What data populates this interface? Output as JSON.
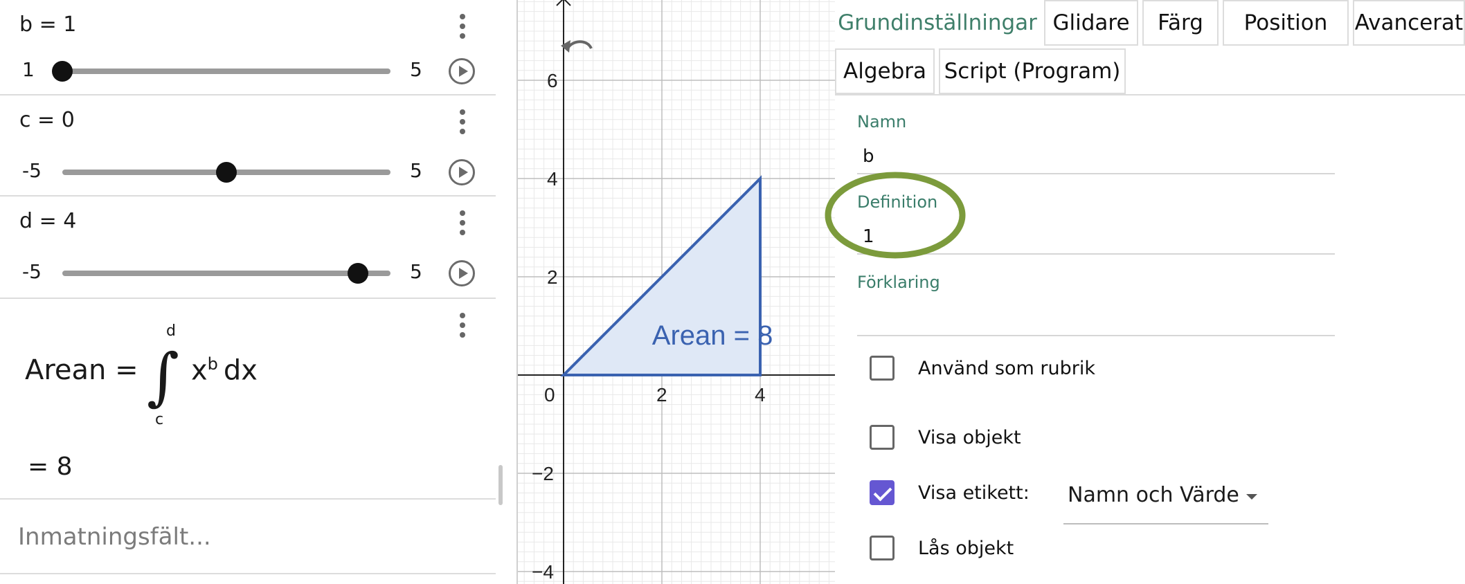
{
  "algebra": {
    "sliders": [
      {
        "definition": "b = 1",
        "min": "1",
        "max": "5",
        "value": 1,
        "range": [
          1,
          5
        ]
      },
      {
        "definition": "c = 0",
        "min": "-5",
        "max": "5",
        "value": 0,
        "range": [
          -5,
          5
        ]
      },
      {
        "definition": "d = 4",
        "min": "-5",
        "max": "5",
        "value": 4,
        "range": [
          -5,
          5
        ]
      }
    ],
    "integral": {
      "lhs": "Arean =",
      "upper": "d",
      "lower": "c",
      "base": "x",
      "exponent": "b",
      "dx": "dx",
      "result": "= 8"
    },
    "input_placeholder": "Inmatningsfält..."
  },
  "graphics": {
    "x_ticks": [
      "0",
      "2",
      "4"
    ],
    "y_ticks": [
      "6",
      "4",
      "2",
      "−2",
      "−4"
    ],
    "area_label": "Arean = 8",
    "colors": {
      "polygon_stroke": "#3a62b0",
      "polygon_fill": "#dfe8f6",
      "grid": "#e8e8e8",
      "major_grid": "#bdbdbd"
    }
  },
  "properties": {
    "tabs": [
      "Grundinställningar",
      "Glidare",
      "Färg",
      "Position",
      "Avancerat",
      "Algebra",
      "Script (Program)"
    ],
    "name_label": "Namn",
    "name_value": "b",
    "definition_label": "Definition",
    "definition_value": "1",
    "caption_label": "Förklaring",
    "caption_value": "",
    "checkboxes": [
      {
        "label": "Använd som rubrik",
        "checked": false
      },
      {
        "label": "Visa objekt",
        "checked": false
      },
      {
        "label": "Visa etikett:",
        "checked": true
      },
      {
        "label": "Lås objekt",
        "checked": false
      }
    ],
    "label_dropdown": "Namn och Värde",
    "accent_color": "#3f7f6a",
    "highlight_color": "#7c9b3c"
  }
}
